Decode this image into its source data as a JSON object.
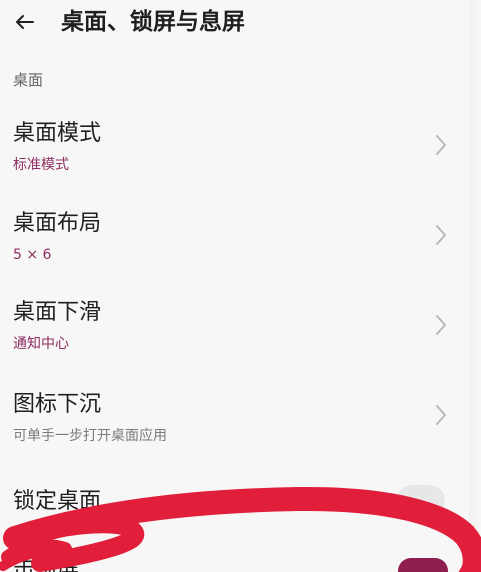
{
  "header": {
    "title": "桌面、锁屏与息屏"
  },
  "section": {
    "label": "桌面"
  },
  "items": [
    {
      "title": "桌面模式",
      "subtitle": "标准模式"
    },
    {
      "title": "桌面布局",
      "subtitle": "5 × 6"
    },
    {
      "title": "桌面下滑",
      "subtitle": "通知中心"
    },
    {
      "title": "图标下沉",
      "subtitle": "可单手一步打开桌面应用"
    },
    {
      "title": "锁定桌面",
      "subtitle": ""
    },
    {
      "title": "击锁屏",
      "subtitle": ""
    }
  ],
  "icons": {
    "back": "arrow-left-icon",
    "chevron": "chevron-right-icon"
  },
  "colors": {
    "accent": "#8e2f61",
    "annotation": "#e11f3b",
    "toggle_off": "#e7e7e7",
    "toggle_on": "#8e1e4d"
  },
  "states": {
    "lock_desktop_enabled": false,
    "double_tap_lock_enabled": true
  }
}
